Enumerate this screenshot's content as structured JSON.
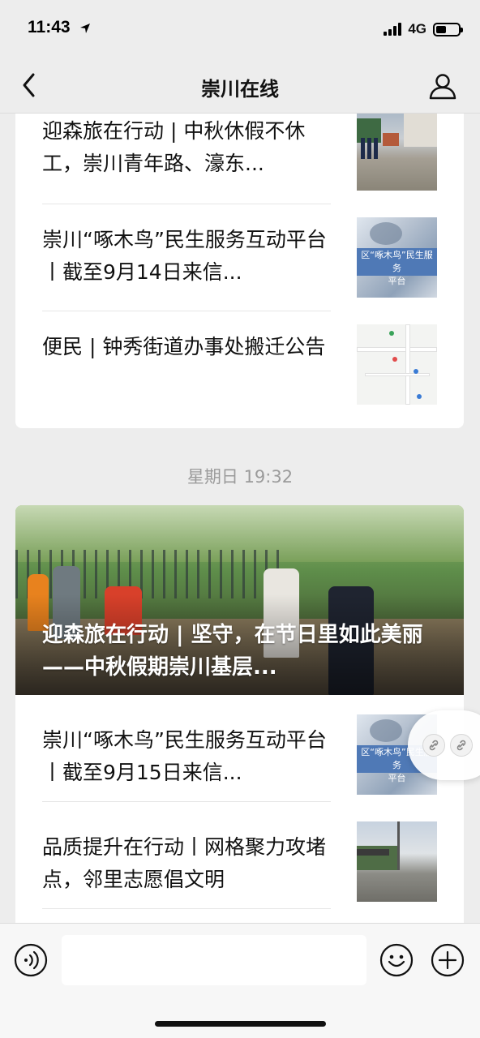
{
  "status_bar": {
    "time": "11:43",
    "network": "4G",
    "battery_level": 0.45
  },
  "nav": {
    "title": "崇川在线"
  },
  "card1": {
    "items": [
      {
        "title": "迎森旅在行动 | 中秋休假不休工，崇川青年路、濠东..."
      },
      {
        "title": "崇川“啄木鸟”民生服务互动平台丨截至9月14日来信...",
        "thumb_text": "区“啄木鸟”民生服务\n平台"
      },
      {
        "title": "便民 | 钟秀街道办事处搬迁公告"
      }
    ]
  },
  "timestamp": "星期日 19:32",
  "card2": {
    "hero_title": "迎森旅在行动 | 坚守，在节日里如此美丽——中秋假期崇川基层...",
    "items": [
      {
        "title": "崇川“啄木鸟”民生服务互动平台丨截至9月15日来信...",
        "thumb_text": "区“啄木鸟”民生服务\n平台"
      },
      {
        "title": "品质提升在行动丨网格聚力攻堵点，邻里志愿倡文明"
      }
    ]
  },
  "icons": {
    "back": "chevron-left-icon",
    "profile": "person-icon",
    "voice": "voice-icon",
    "emoji": "emoji-icon",
    "plus": "plus-icon",
    "link": "link-icon"
  },
  "colors": {
    "background": "#ededed",
    "card": "#ffffff",
    "timestamp": "#9b9b9b"
  }
}
